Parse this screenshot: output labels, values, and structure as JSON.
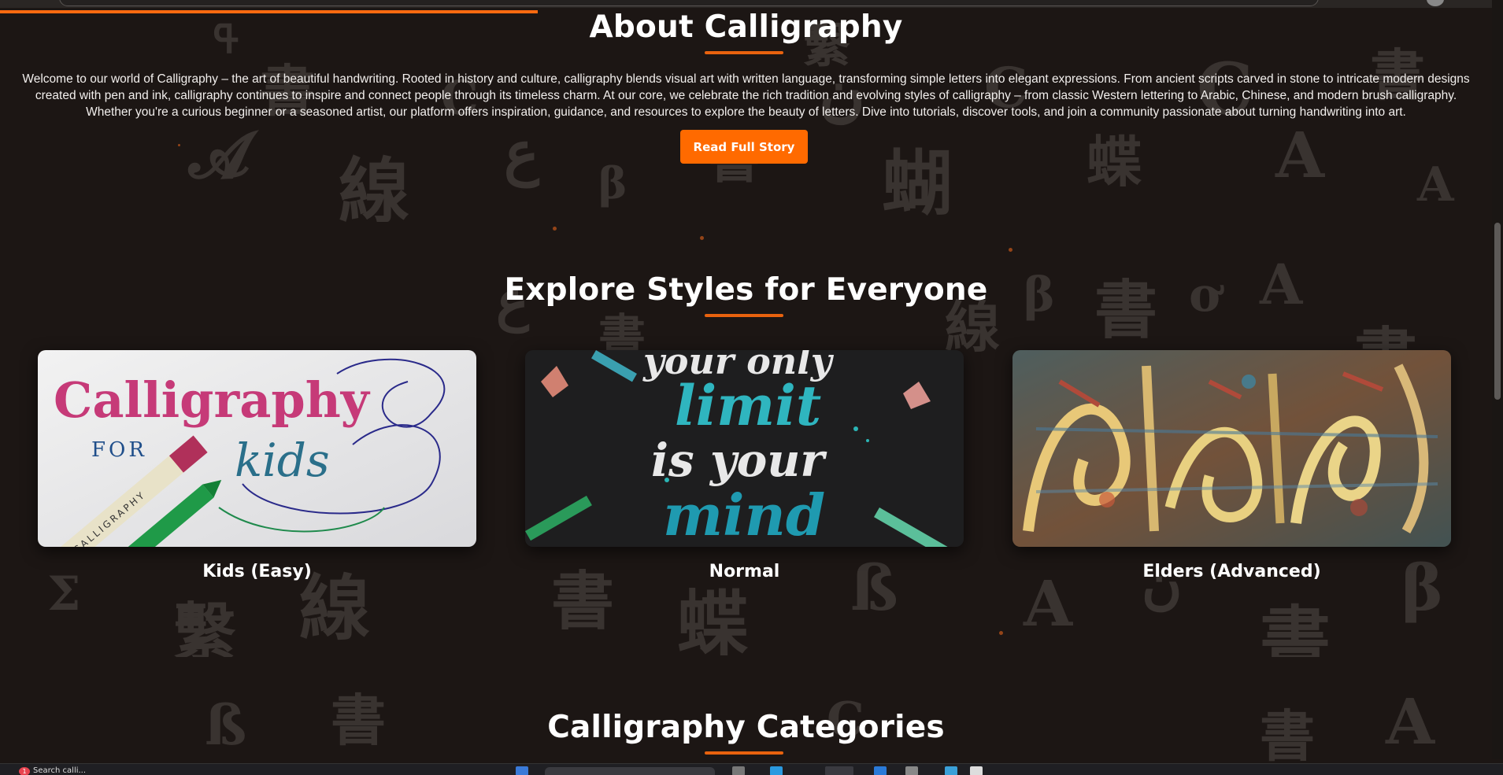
{
  "about": {
    "title": "About Calligraphy",
    "body": "Welcome to our world of Calligraphy – the art of beautiful handwriting. Rooted in history and culture, calligraphy blends visual art with written language, transforming simple letters into elegant expressions. From ancient scripts carved in stone to intricate modern designs created with pen and ink, calligraphy continues to inspire and connect people through its timeless charm. At our core, we celebrate the rich tradition and evolving styles of calligraphy – from classic Western lettering to Arabic, Chinese, and modern brush calligraphy. Whether you're a curious beginner or a seasoned artist, our platform offers inspiration, guidance, and resources to explore the beauty of letters. Dive into tutorials, discover tools, and join a community passionate about turning handwriting into art.",
    "button_label": "Read Full Story"
  },
  "styles": {
    "title": "Explore Styles for Everyone",
    "cards": [
      {
        "label": "Kids (Easy)",
        "image_text_1": "Calligraphy",
        "image_text_2": "FOR",
        "image_text_3": "kids",
        "image_text_4": "CALLIGRAPHY"
      },
      {
        "label": "Normal",
        "image_text_1": "your only",
        "image_text_2": "limit",
        "image_text_3": "is your",
        "image_text_4": "mind"
      },
      {
        "label": "Elders (Advanced)"
      }
    ]
  },
  "categories": {
    "title": "Calligraphy Categories"
  },
  "taskbar": {
    "notification_count": "1",
    "window_label": "Search calli..."
  },
  "colors": {
    "accent": "#ff6a00",
    "background": "#1c1614",
    "underline": "#e8620e"
  }
}
